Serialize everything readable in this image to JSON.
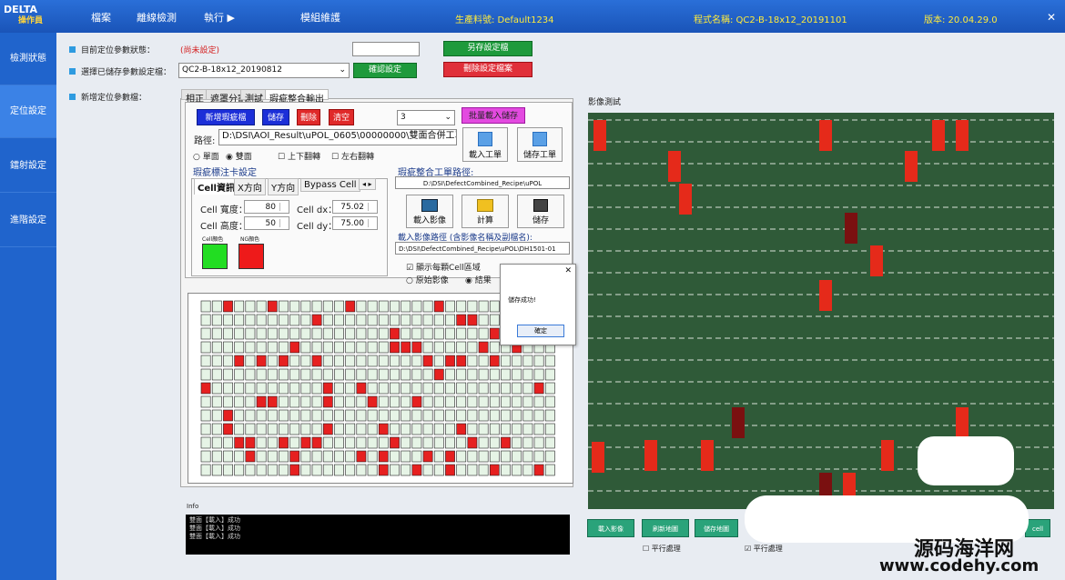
{
  "app": {
    "logo_text": "DELTA",
    "logo_sub": "操作員"
  },
  "menu": [
    "檔案",
    "離線檢測",
    "執行 ▶",
    "",
    "模組維護"
  ],
  "header": {
    "product": "生產料號: Default1234",
    "program": "程式名稱: QC2-B-18x12_20191101",
    "version": "版本: 20.04.29.0"
  },
  "sidebar": [
    "檢測狀態",
    "定位設定",
    "鐳射設定",
    "進階設定"
  ],
  "form": {
    "current_status_label": "目前定位參數狀態：",
    "current_status_value": "(尚未設定)",
    "saved_label": "選擇已儲存參數設定檔：",
    "saved_value": "QC2-B-18x12_20190812",
    "new_label": "新增定位參數檔：",
    "save_as": "另存設定檔",
    "confirm": "確認設定",
    "delete": "刪除設定檔案"
  },
  "tabs": [
    "相正",
    "遮罩分割",
    "測試",
    "瑕疵整合輸出"
  ],
  "defect": {
    "new_btn": "新增瑕疵檔",
    "save_btn": "儲存",
    "delete_btn": "刪除",
    "clear_btn": "清空",
    "combo": "3",
    "batch_btn": "批量載入儲存",
    "path_label": "路徑:",
    "path_value": "D:\\DSI\\AOI_Result\\uPOL_0605\\00000000\\雙面合併工單",
    "single": "單面",
    "double": "雙面",
    "flip_ud": "上下翻轉",
    "flip_lr": "左右翻轉",
    "load_order": "載入工單",
    "save_order": "儲存工單"
  },
  "mark": {
    "title": "瑕疵標注卡設定",
    "tabs": [
      "Cell資訊",
      "X方向",
      "Y方向",
      "Bypass Cell"
    ],
    "width_label": "Cell 寬度：",
    "width_value": "80",
    "height_label": "Cell 高度：",
    "height_value": "50",
    "dx_label": "Cell dx：",
    "dx_value": "75.02",
    "dy_label": "Cell dy：",
    "dy_value": "75.00",
    "cell_color": "Cell顏色",
    "ng_color": "NG顏色"
  },
  "merge": {
    "path_title": "瑕疵整合工單路徑:",
    "path_value": "D:\\DSI\\DefectCombined_Recipe\\uPOL",
    "load_img": "載入影像",
    "calc": "計算",
    "save": "儲存",
    "img_path_title": "載入影像路徑 (含影像名稱及副檔名):",
    "img_path_value": "D:\\DSI\\DefectCombined_Recipe\\uPOL\\DH1501-01",
    "show_cells": "顯示每顆Cell區域",
    "original": "原始影像",
    "result": "結果"
  },
  "dialog": {
    "message": "儲存成功!",
    "ok": "確定"
  },
  "info": {
    "title": "Info",
    "lines": [
      "雙面【載入】成功",
      "雙面【載入】成功",
      "雙面【載入】成功"
    ]
  },
  "image_test": {
    "title": "影像測試",
    "buttons": [
      "載入影像",
      "刷新地圖",
      "儲存地圖",
      "cell"
    ],
    "parallel1": "平行處理",
    "parallel2": "平行處理"
  },
  "watermark": {
    "cn": "源码海洋网",
    "url": "www.codehy.com"
  },
  "colors": {
    "cell": "#22dd22",
    "ng": "#ee1a1a"
  }
}
